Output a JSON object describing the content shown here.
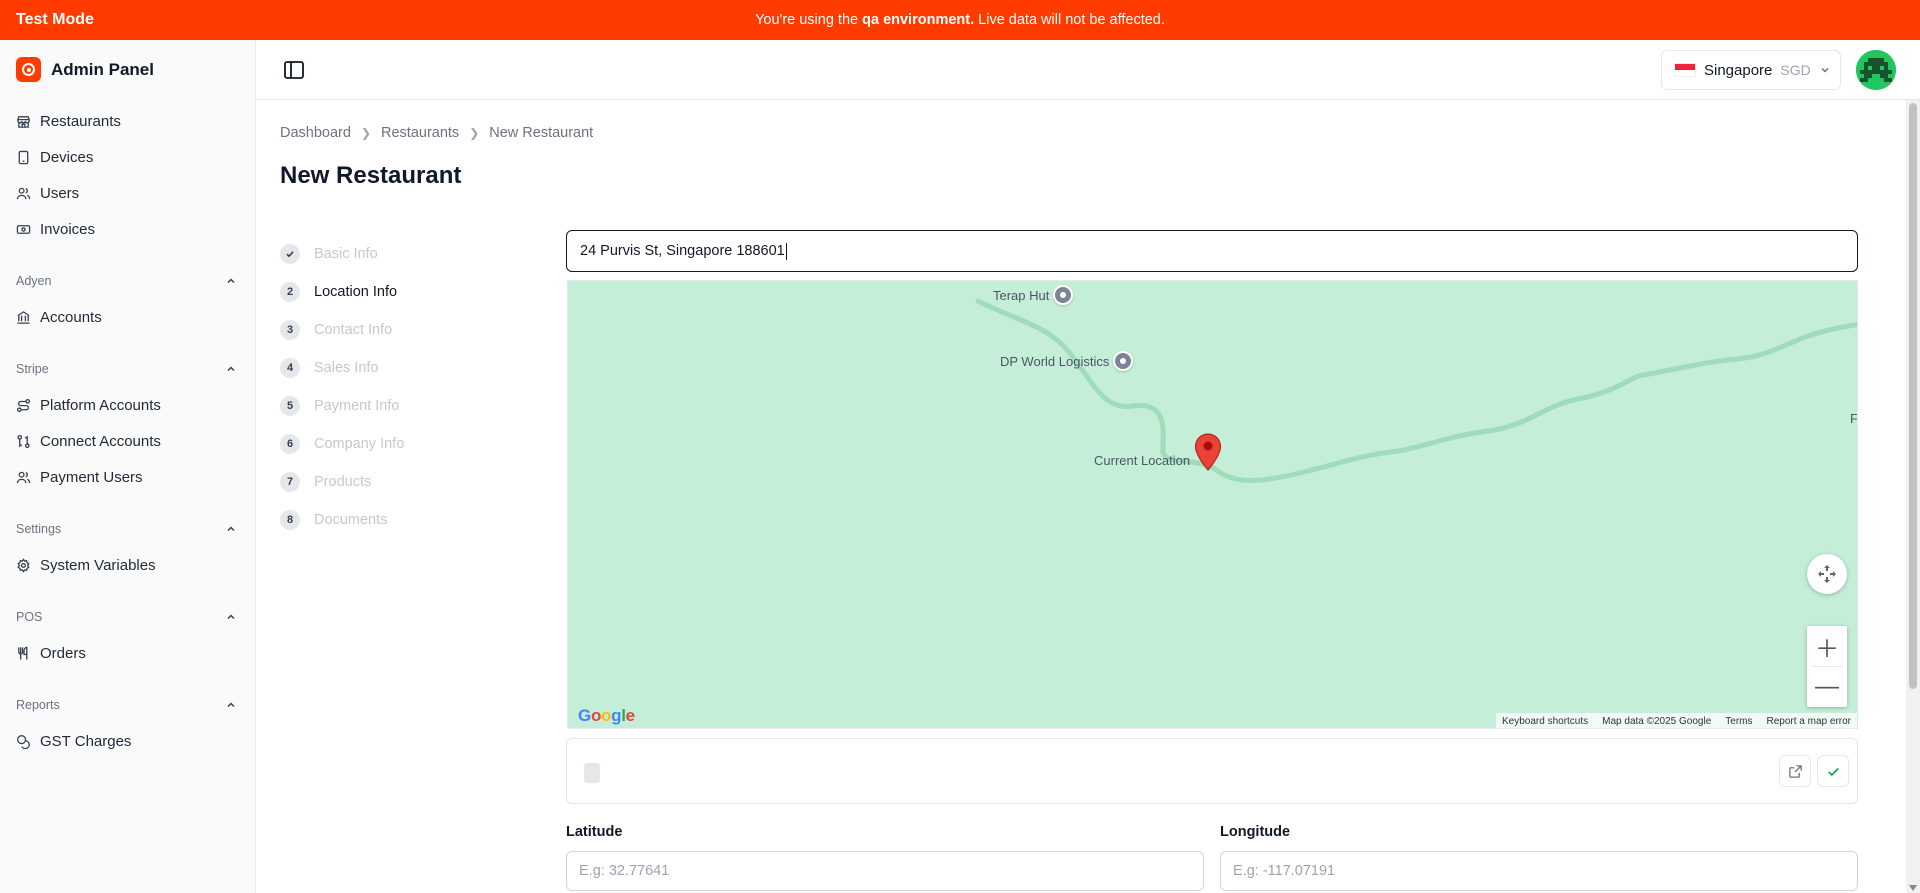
{
  "banner": {
    "mode": "Test Mode",
    "msg_pre": "You're using the ",
    "msg_env": "qa environment.",
    "msg_post": " Live data will not be affected.",
    "color": "#ff3b00"
  },
  "sidebar": {
    "brand": "Admin Panel",
    "items": [
      {
        "label": "Restaurants",
        "icon": "store-icon"
      },
      {
        "label": "Devices",
        "icon": "tablet-icon"
      },
      {
        "label": "Users",
        "icon": "users-icon"
      },
      {
        "label": "Invoices",
        "icon": "banknote-icon"
      }
    ],
    "groups": [
      {
        "title": "Adyen",
        "items": [
          {
            "label": "Accounts",
            "icon": "bank-icon"
          }
        ]
      },
      {
        "title": "Stripe",
        "items": [
          {
            "label": "Platform Accounts",
            "icon": "route-icon"
          },
          {
            "label": "Connect Accounts",
            "icon": "git-compare-icon"
          },
          {
            "label": "Payment Users",
            "icon": "users-icon"
          }
        ]
      },
      {
        "title": "Settings",
        "items": [
          {
            "label": "System Variables",
            "icon": "gear-icon"
          }
        ]
      },
      {
        "title": "POS",
        "items": [
          {
            "label": "Orders",
            "icon": "utensils-icon"
          }
        ]
      },
      {
        "title": "Reports",
        "items": [
          {
            "label": "GST Charges",
            "icon": "coins-icon"
          }
        ]
      }
    ]
  },
  "header": {
    "country": "Singapore",
    "currency": "SGD"
  },
  "breadcrumb": [
    "Dashboard",
    "Restaurants",
    "New Restaurant"
  ],
  "page_title": "New Restaurant",
  "steps": [
    {
      "num": "",
      "label": "Basic Info",
      "state": "done"
    },
    {
      "num": "2",
      "label": "Location Info",
      "state": "active"
    },
    {
      "num": "3",
      "label": "Contact Info",
      "state": "pending"
    },
    {
      "num": "4",
      "label": "Sales Info",
      "state": "pending"
    },
    {
      "num": "5",
      "label": "Payment Info",
      "state": "pending"
    },
    {
      "num": "6",
      "label": "Company Info",
      "state": "pending"
    },
    {
      "num": "7",
      "label": "Products",
      "state": "pending"
    },
    {
      "num": "8",
      "label": "Documents",
      "state": "pending"
    }
  ],
  "address_value": "24 Purvis St, Singapore 188601",
  "map": {
    "pois": [
      "Terap Hut",
      "DP World Logistics"
    ],
    "current_label": "Current Location",
    "edge_label": "F",
    "attribution": [
      "Keyboard shortcuts",
      "Map data ©2025 Google",
      "Terms",
      "Report a map error"
    ]
  },
  "fields": {
    "latitude_label": "Latitude",
    "latitude_placeholder": "E.g: 32.77641",
    "longitude_label": "Longitude",
    "longitude_placeholder": "E.g: -117.07191"
  }
}
